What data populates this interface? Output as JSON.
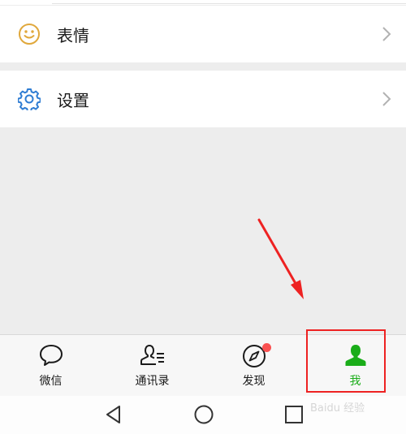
{
  "menu": {
    "items": [
      {
        "label": "表情",
        "icon": "smile-icon"
      },
      {
        "label": "设置",
        "icon": "gear-icon"
      }
    ]
  },
  "tabbar": {
    "tabs": [
      {
        "label": "微信",
        "icon": "chat-bubble-icon",
        "active": false
      },
      {
        "label": "通讯录",
        "icon": "contacts-icon",
        "active": false
      },
      {
        "label": "发现",
        "icon": "compass-icon",
        "active": false,
        "badge": true
      },
      {
        "label": "我",
        "icon": "person-icon",
        "active": true
      }
    ]
  },
  "navbar": {
    "buttons": [
      "back-icon",
      "home-icon",
      "recents-icon"
    ]
  },
  "watermark": "Baidu 经验",
  "colors": {
    "accent": "#1aad19",
    "icon_yellow": "#e0a83c",
    "icon_blue": "#2f7dd3",
    "badge": "#fa5151",
    "annotation": "#ee2222"
  }
}
